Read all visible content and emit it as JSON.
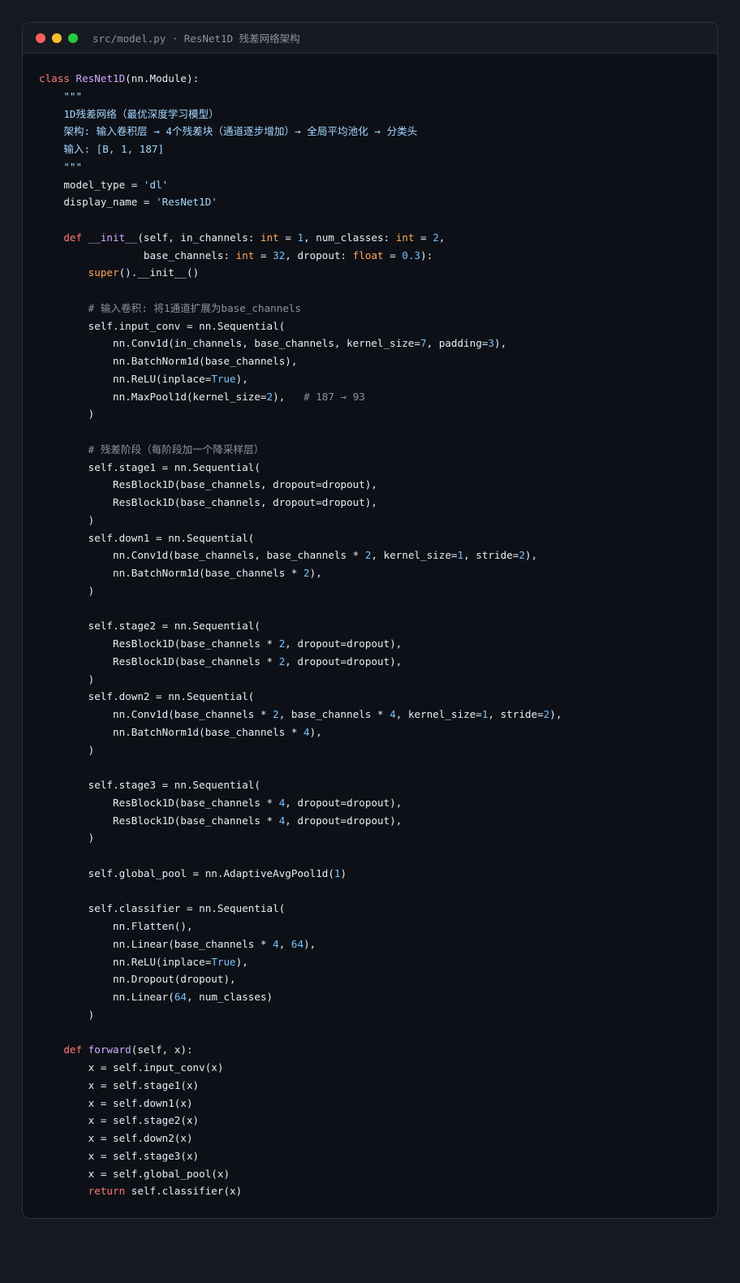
{
  "window": {
    "title": "src/model.py · ResNet1D 残差网络架构",
    "colors": {
      "page_background": "#151a21",
      "window_background": "#0d1117",
      "titlebar_background": "#161b22",
      "close": "#ff5f57",
      "minimize": "#febc2e",
      "maximize": "#28c840"
    }
  },
  "code": {
    "language": "python",
    "lines": [
      [
        [
          "kw",
          "class "
        ],
        [
          "cls",
          "ResNet1D"
        ],
        [
          "txt",
          "(nn.Module):"
        ]
      ],
      [
        [
          "doc",
          "    \"\"\""
        ]
      ],
      [
        [
          "doc",
          "    1D残差网络（最优深度学习模型）"
        ]
      ],
      [
        [
          "doc",
          "    架构: 输入卷积层 → 4个残差块（通道逐步增加）→ 全局平均池化 → 分类头"
        ]
      ],
      [
        [
          "doc",
          "    输入: [B, 1, 187]"
        ]
      ],
      [
        [
          "doc",
          "    \"\"\""
        ]
      ],
      [
        [
          "txt",
          "    model_type = "
        ],
        [
          "str",
          "'dl'"
        ]
      ],
      [
        [
          "txt",
          "    display_name = "
        ],
        [
          "str",
          "'ResNet1D'"
        ]
      ],
      [],
      [
        [
          "kw",
          "    def "
        ],
        [
          "fn",
          "__init__"
        ],
        [
          "txt",
          "(self, in_channels: "
        ],
        [
          "ty",
          "int"
        ],
        [
          "txt",
          " = "
        ],
        [
          "num",
          "1"
        ],
        [
          "txt",
          ", num_classes: "
        ],
        [
          "ty",
          "int"
        ],
        [
          "txt",
          " = "
        ],
        [
          "num",
          "2"
        ],
        [
          "txt",
          ","
        ]
      ],
      [
        [
          "txt",
          "                 base_channels: "
        ],
        [
          "ty",
          "int"
        ],
        [
          "txt",
          " = "
        ],
        [
          "num",
          "32"
        ],
        [
          "txt",
          ", dropout: "
        ],
        [
          "ty",
          "float"
        ],
        [
          "txt",
          " = "
        ],
        [
          "num",
          "0.3"
        ],
        [
          "txt",
          "):"
        ]
      ],
      [
        [
          "bi",
          "        super"
        ],
        [
          "txt",
          "().__init__()"
        ]
      ],
      [],
      [
        [
          "cm",
          "        # 输入卷积: 将1通道扩展为base_channels"
        ]
      ],
      [
        [
          "txt",
          "        self.input_conv = nn.Sequential("
        ]
      ],
      [
        [
          "txt",
          "            nn.Conv1d(in_channels, base_channels, kernel_size="
        ],
        [
          "num",
          "7"
        ],
        [
          "txt",
          ", padding="
        ],
        [
          "num",
          "3"
        ],
        [
          "txt",
          "),"
        ]
      ],
      [
        [
          "txt",
          "            nn.BatchNorm1d(base_channels),"
        ]
      ],
      [
        [
          "txt",
          "            nn.ReLU(inplace="
        ],
        [
          "cst",
          "True"
        ],
        [
          "txt",
          "),"
        ]
      ],
      [
        [
          "txt",
          "            nn.MaxPool1d(kernel_size="
        ],
        [
          "num",
          "2"
        ],
        [
          "txt",
          "),   "
        ],
        [
          "cm",
          "# 187 → 93"
        ]
      ],
      [
        [
          "txt",
          "        )"
        ]
      ],
      [],
      [
        [
          "cm",
          "        # 残差阶段（每阶段加一个降采样层）"
        ]
      ],
      [
        [
          "txt",
          "        self.stage1 = nn.Sequential("
        ]
      ],
      [
        [
          "txt",
          "            ResBlock1D(base_channels, dropout=dropout),"
        ]
      ],
      [
        [
          "txt",
          "            ResBlock1D(base_channels, dropout=dropout),"
        ]
      ],
      [
        [
          "txt",
          "        )"
        ]
      ],
      [
        [
          "txt",
          "        self.down1 = nn.Sequential("
        ]
      ],
      [
        [
          "txt",
          "            nn.Conv1d(base_channels, base_channels * "
        ],
        [
          "num",
          "2"
        ],
        [
          "txt",
          ", kernel_size="
        ],
        [
          "num",
          "1"
        ],
        [
          "txt",
          ", stride="
        ],
        [
          "num",
          "2"
        ],
        [
          "txt",
          "),"
        ]
      ],
      [
        [
          "txt",
          "            nn.BatchNorm1d(base_channels * "
        ],
        [
          "num",
          "2"
        ],
        [
          "txt",
          "),"
        ]
      ],
      [
        [
          "txt",
          "        )"
        ]
      ],
      [],
      [
        [
          "txt",
          "        self.stage2 = nn.Sequential("
        ]
      ],
      [
        [
          "txt",
          "            ResBlock1D(base_channels * "
        ],
        [
          "num",
          "2"
        ],
        [
          "txt",
          ", dropout=dropout),"
        ]
      ],
      [
        [
          "txt",
          "            ResBlock1D(base_channels * "
        ],
        [
          "num",
          "2"
        ],
        [
          "txt",
          ", dropout=dropout),"
        ]
      ],
      [
        [
          "txt",
          "        )"
        ]
      ],
      [
        [
          "txt",
          "        self.down2 = nn.Sequential("
        ]
      ],
      [
        [
          "txt",
          "            nn.Conv1d(base_channels * "
        ],
        [
          "num",
          "2"
        ],
        [
          "txt",
          ", base_channels * "
        ],
        [
          "num",
          "4"
        ],
        [
          "txt",
          ", kernel_size="
        ],
        [
          "num",
          "1"
        ],
        [
          "txt",
          ", stride="
        ],
        [
          "num",
          "2"
        ],
        [
          "txt",
          "),"
        ]
      ],
      [
        [
          "txt",
          "            nn.BatchNorm1d(base_channels * "
        ],
        [
          "num",
          "4"
        ],
        [
          "txt",
          "),"
        ]
      ],
      [
        [
          "txt",
          "        )"
        ]
      ],
      [],
      [
        [
          "txt",
          "        self.stage3 = nn.Sequential("
        ]
      ],
      [
        [
          "txt",
          "            ResBlock1D(base_channels * "
        ],
        [
          "num",
          "4"
        ],
        [
          "txt",
          ", dropout=dropout),"
        ]
      ],
      [
        [
          "txt",
          "            ResBlock1D(base_channels * "
        ],
        [
          "num",
          "4"
        ],
        [
          "txt",
          ", dropout=dropout),"
        ]
      ],
      [
        [
          "txt",
          "        )"
        ]
      ],
      [],
      [
        [
          "txt",
          "        self.global_pool = nn.AdaptiveAvgPool1d("
        ],
        [
          "num",
          "1"
        ],
        [
          "txt",
          ")"
        ]
      ],
      [],
      [
        [
          "txt",
          "        self.classifier = nn.Sequential("
        ]
      ],
      [
        [
          "txt",
          "            nn.Flatten(),"
        ]
      ],
      [
        [
          "txt",
          "            nn.Linear(base_channels * "
        ],
        [
          "num",
          "4"
        ],
        [
          "txt",
          ", "
        ],
        [
          "num",
          "64"
        ],
        [
          "txt",
          "),"
        ]
      ],
      [
        [
          "txt",
          "            nn.ReLU(inplace="
        ],
        [
          "cst",
          "True"
        ],
        [
          "txt",
          "),"
        ]
      ],
      [
        [
          "txt",
          "            nn.Dropout(dropout),"
        ]
      ],
      [
        [
          "txt",
          "            nn.Linear("
        ],
        [
          "num",
          "64"
        ],
        [
          "txt",
          ", num_classes)"
        ]
      ],
      [
        [
          "txt",
          "        )"
        ]
      ],
      [],
      [
        [
          "kw",
          "    def "
        ],
        [
          "fn",
          "forward"
        ],
        [
          "txt",
          "(self, x):"
        ]
      ],
      [
        [
          "txt",
          "        x = self.input_conv(x)"
        ]
      ],
      [
        [
          "txt",
          "        x = self.stage1(x)"
        ]
      ],
      [
        [
          "txt",
          "        x = self.down1(x)"
        ]
      ],
      [
        [
          "txt",
          "        x = self.stage2(x)"
        ]
      ],
      [
        [
          "txt",
          "        x = self.down2(x)"
        ]
      ],
      [
        [
          "txt",
          "        x = self.stage3(x)"
        ]
      ],
      [
        [
          "txt",
          "        x = self.global_pool(x)"
        ]
      ],
      [
        [
          "kw",
          "        return "
        ],
        [
          "txt",
          "self.classifier(x)"
        ]
      ]
    ]
  }
}
